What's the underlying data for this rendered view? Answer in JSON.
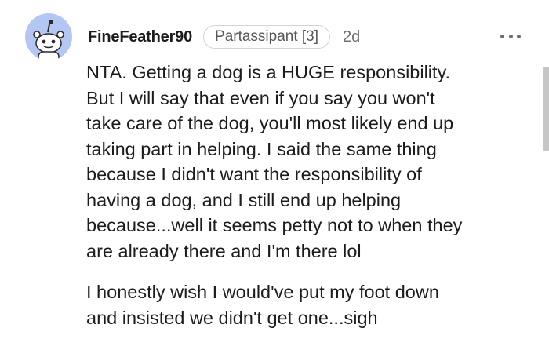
{
  "comment": {
    "avatar_icon": "reddit-snoo-icon",
    "username": "FineFeather90",
    "flair": "Partassipant [3]",
    "timestamp": "2d",
    "more_icon": "more-options-icon",
    "paragraphs": [
      "NTA. Getting a dog is a HUGE responsibility.\nBut I will say that even if you say you won't\ntake care of the dog, you'll most likely end up\ntaking part in helping. I said the same thing\nbecause I didn't want the responsibility of\nhaving a dog, and I still end up helping\nbecause...well it seems petty not to when they\nare already there and I'm there lol",
      "I honestly wish I would've put my foot down\nand insisted we didn't get one...sigh"
    ]
  },
  "colors": {
    "avatar_bg": "#b4c6f4",
    "text": "#1c1c1c",
    "muted": "#6f6f6f"
  }
}
